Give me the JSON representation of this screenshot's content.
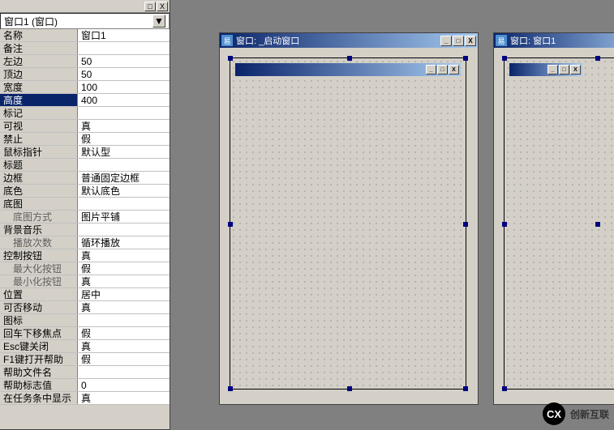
{
  "panel": {
    "selector": "窗口1 (窗口)",
    "rows": [
      {
        "label": "名称",
        "value": "窗口1"
      },
      {
        "label": "备注",
        "value": ""
      },
      {
        "label": "左边",
        "value": "50"
      },
      {
        "label": "顶边",
        "value": "50"
      },
      {
        "label": "宽度",
        "value": "100"
      },
      {
        "label": "高度",
        "value": "400",
        "selected": true
      },
      {
        "label": "标记",
        "value": ""
      },
      {
        "label": "可视",
        "value": "真"
      },
      {
        "label": "禁止",
        "value": "假"
      },
      {
        "label": "鼠标指针",
        "value": "默认型"
      },
      {
        "label": "标题",
        "value": ""
      },
      {
        "label": "边框",
        "value": "普通固定边框"
      },
      {
        "label": "底色",
        "value": "默认底色"
      },
      {
        "label": "底图",
        "value": ""
      },
      {
        "label": "底图方式",
        "value": "图片平铺",
        "indent": true
      },
      {
        "label": "背景音乐",
        "value": ""
      },
      {
        "label": "播放次数",
        "value": "循环播放",
        "indent": true
      },
      {
        "label": "控制按钮",
        "value": "真"
      },
      {
        "label": "最大化按钮",
        "value": "假",
        "indent": true
      },
      {
        "label": "最小化按钮",
        "value": "真",
        "indent": true
      },
      {
        "label": "位置",
        "value": "居中"
      },
      {
        "label": "可否移动",
        "value": "真"
      },
      {
        "label": "图标",
        "value": ""
      },
      {
        "label": "回车下移焦点",
        "value": "假"
      },
      {
        "label": "Esc键关闭",
        "value": "真"
      },
      {
        "label": "F1键打开帮助",
        "value": "假"
      },
      {
        "label": "帮助文件名",
        "value": ""
      },
      {
        "label": "帮助标志值",
        "value": "0"
      },
      {
        "label": "在任务条中显示",
        "value": "真"
      }
    ]
  },
  "win1": {
    "title": "窗口: _启动窗口",
    "icon": "易"
  },
  "win2": {
    "title": "窗口: 窗口1",
    "icon": "易"
  },
  "watermark": {
    "logo": "CX",
    "text": "创新互联"
  },
  "btn": {
    "min": "_",
    "max": "□",
    "close": "X",
    "down": "▼"
  }
}
